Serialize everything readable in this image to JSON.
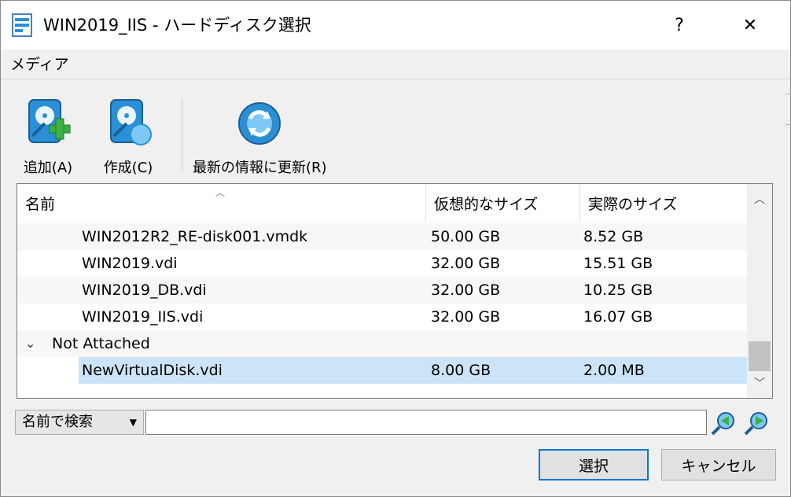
{
  "window": {
    "title": "WIN2019_IIS - ハードディスク選択",
    "help_label": "?",
    "close_label": "✕"
  },
  "menubar": {
    "media_label": "メディア"
  },
  "toolbar": {
    "add_label": "追加(A)",
    "create_label": "作成(C)",
    "refresh_label": "最新の情報に更新(R)"
  },
  "table": {
    "columns": [
      "名前",
      "仮想的なサイズ",
      "実際のサイズ"
    ],
    "rows": [
      {
        "name": "WIN2012R2_RE-disk001.vmdk",
        "virtual_size": "50.00 GB",
        "actual_size": "8.52 GB"
      },
      {
        "name": "WIN2019.vdi",
        "virtual_size": "32.00 GB",
        "actual_size": "15.51 GB"
      },
      {
        "name": "WIN2019_DB.vdi",
        "virtual_size": "32.00 GB",
        "actual_size": "10.25 GB"
      },
      {
        "name": "WIN2019_IIS.vdi",
        "virtual_size": "32.00 GB",
        "actual_size": "16.07 GB"
      }
    ],
    "group": {
      "label": "Not Attached",
      "rows": [
        {
          "name": "NewVirtualDisk.vdi",
          "virtual_size": "8.00 GB",
          "actual_size": "2.00 MB",
          "selected": true
        }
      ]
    }
  },
  "search": {
    "mode_label": "名前で検索",
    "value": ""
  },
  "buttons": {
    "select_label": "選択",
    "cancel_label": "キャンセル"
  },
  "colors": {
    "selection": "#cce4f7",
    "accent": "#0078d7",
    "icon_blue": "#2b8fd6",
    "icon_green": "#3cb043"
  }
}
